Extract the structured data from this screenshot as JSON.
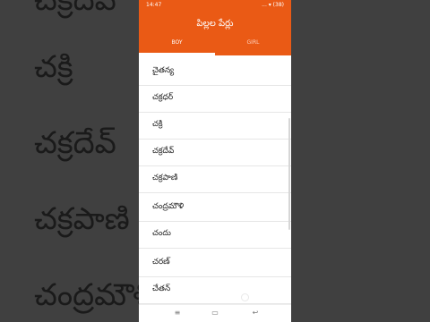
{
  "background_words": [
    "చక్రి",
    "చక్రదేవ్",
    "చక్రపాణి",
    "చంద్రమౌళి"
  ],
  "status_bar": {
    "time": "14:47",
    "icons": "... ▾ (38)"
  },
  "header": {
    "title": "పిల్లల పేర్లు",
    "tabs": [
      {
        "label": "BOY",
        "selected": true
      },
      {
        "label": "GIRL",
        "selected": false
      }
    ],
    "color": "#ea5a15"
  },
  "names": [
    "చైతన్య",
    "చక్రధర్",
    "చక్రి",
    "చక్రదేవ్",
    "చక్రపాణి",
    "చంద్రమౌళి",
    "చందు",
    "చరణ్",
    "చేతన్"
  ],
  "nav_icons": [
    "menu-icon",
    "home-icon",
    "back-icon"
  ]
}
